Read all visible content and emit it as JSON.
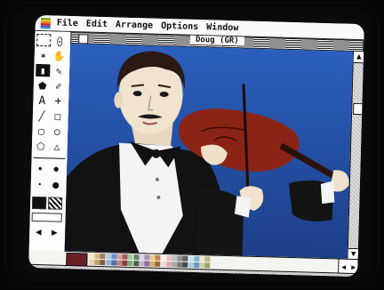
{
  "menubar": {
    "items": [
      "File",
      "Edit",
      "Arrange",
      "Options",
      "Window"
    ]
  },
  "window": {
    "title": "Doug (GR)"
  },
  "palette": {
    "tools": [
      "marquee-tool",
      "lasso-tool",
      "magic-wand-tool",
      "hand-tool",
      "eraser-tool",
      "paint-bucket-tool",
      "pencil-tool",
      "brush-tool",
      "spray-tool",
      "text-tool",
      "crosshair-tool",
      "line-tool",
      "rectangle-tool",
      "rounded-rect-tool",
      "oval-tool",
      "polygon-tool",
      "freeform-tool",
      "pattern-tool"
    ],
    "text_tool_label": "A",
    "crosshair_label": "+"
  },
  "colors": {
    "current": "#6b1f24",
    "swatches": [
      "#f4e8c8",
      "#e8d0a0",
      "#d8b880",
      "#c0a070",
      "#a08060",
      "#806040",
      "#b0c8e8",
      "#90b0d8",
      "#7090c8",
      "#5070b0",
      "#d8a0a0",
      "#c08080",
      "#a06060",
      "#804040",
      "#a0c8a0",
      "#80a880",
      "#608860",
      "#406840",
      "#e0d0e8",
      "#c8b0d0",
      "#a890b8",
      "#8870a0",
      "#f0c890",
      "#d8a870",
      "#c08850",
      "#a06830",
      "#fff0f0",
      "#f0d8d8",
      "#e8c0c0",
      "#d8a8a8",
      "#c0c0c0",
      "#a8a8a8",
      "#909090",
      "#787878",
      "#606060",
      "#484848",
      "#c8e0f0",
      "#a8c8e0",
      "#88b0d0",
      "#6898c0",
      "#e8e8c8",
      "#d0d0a8",
      "#b8b888",
      "#a0a068"
    ]
  }
}
